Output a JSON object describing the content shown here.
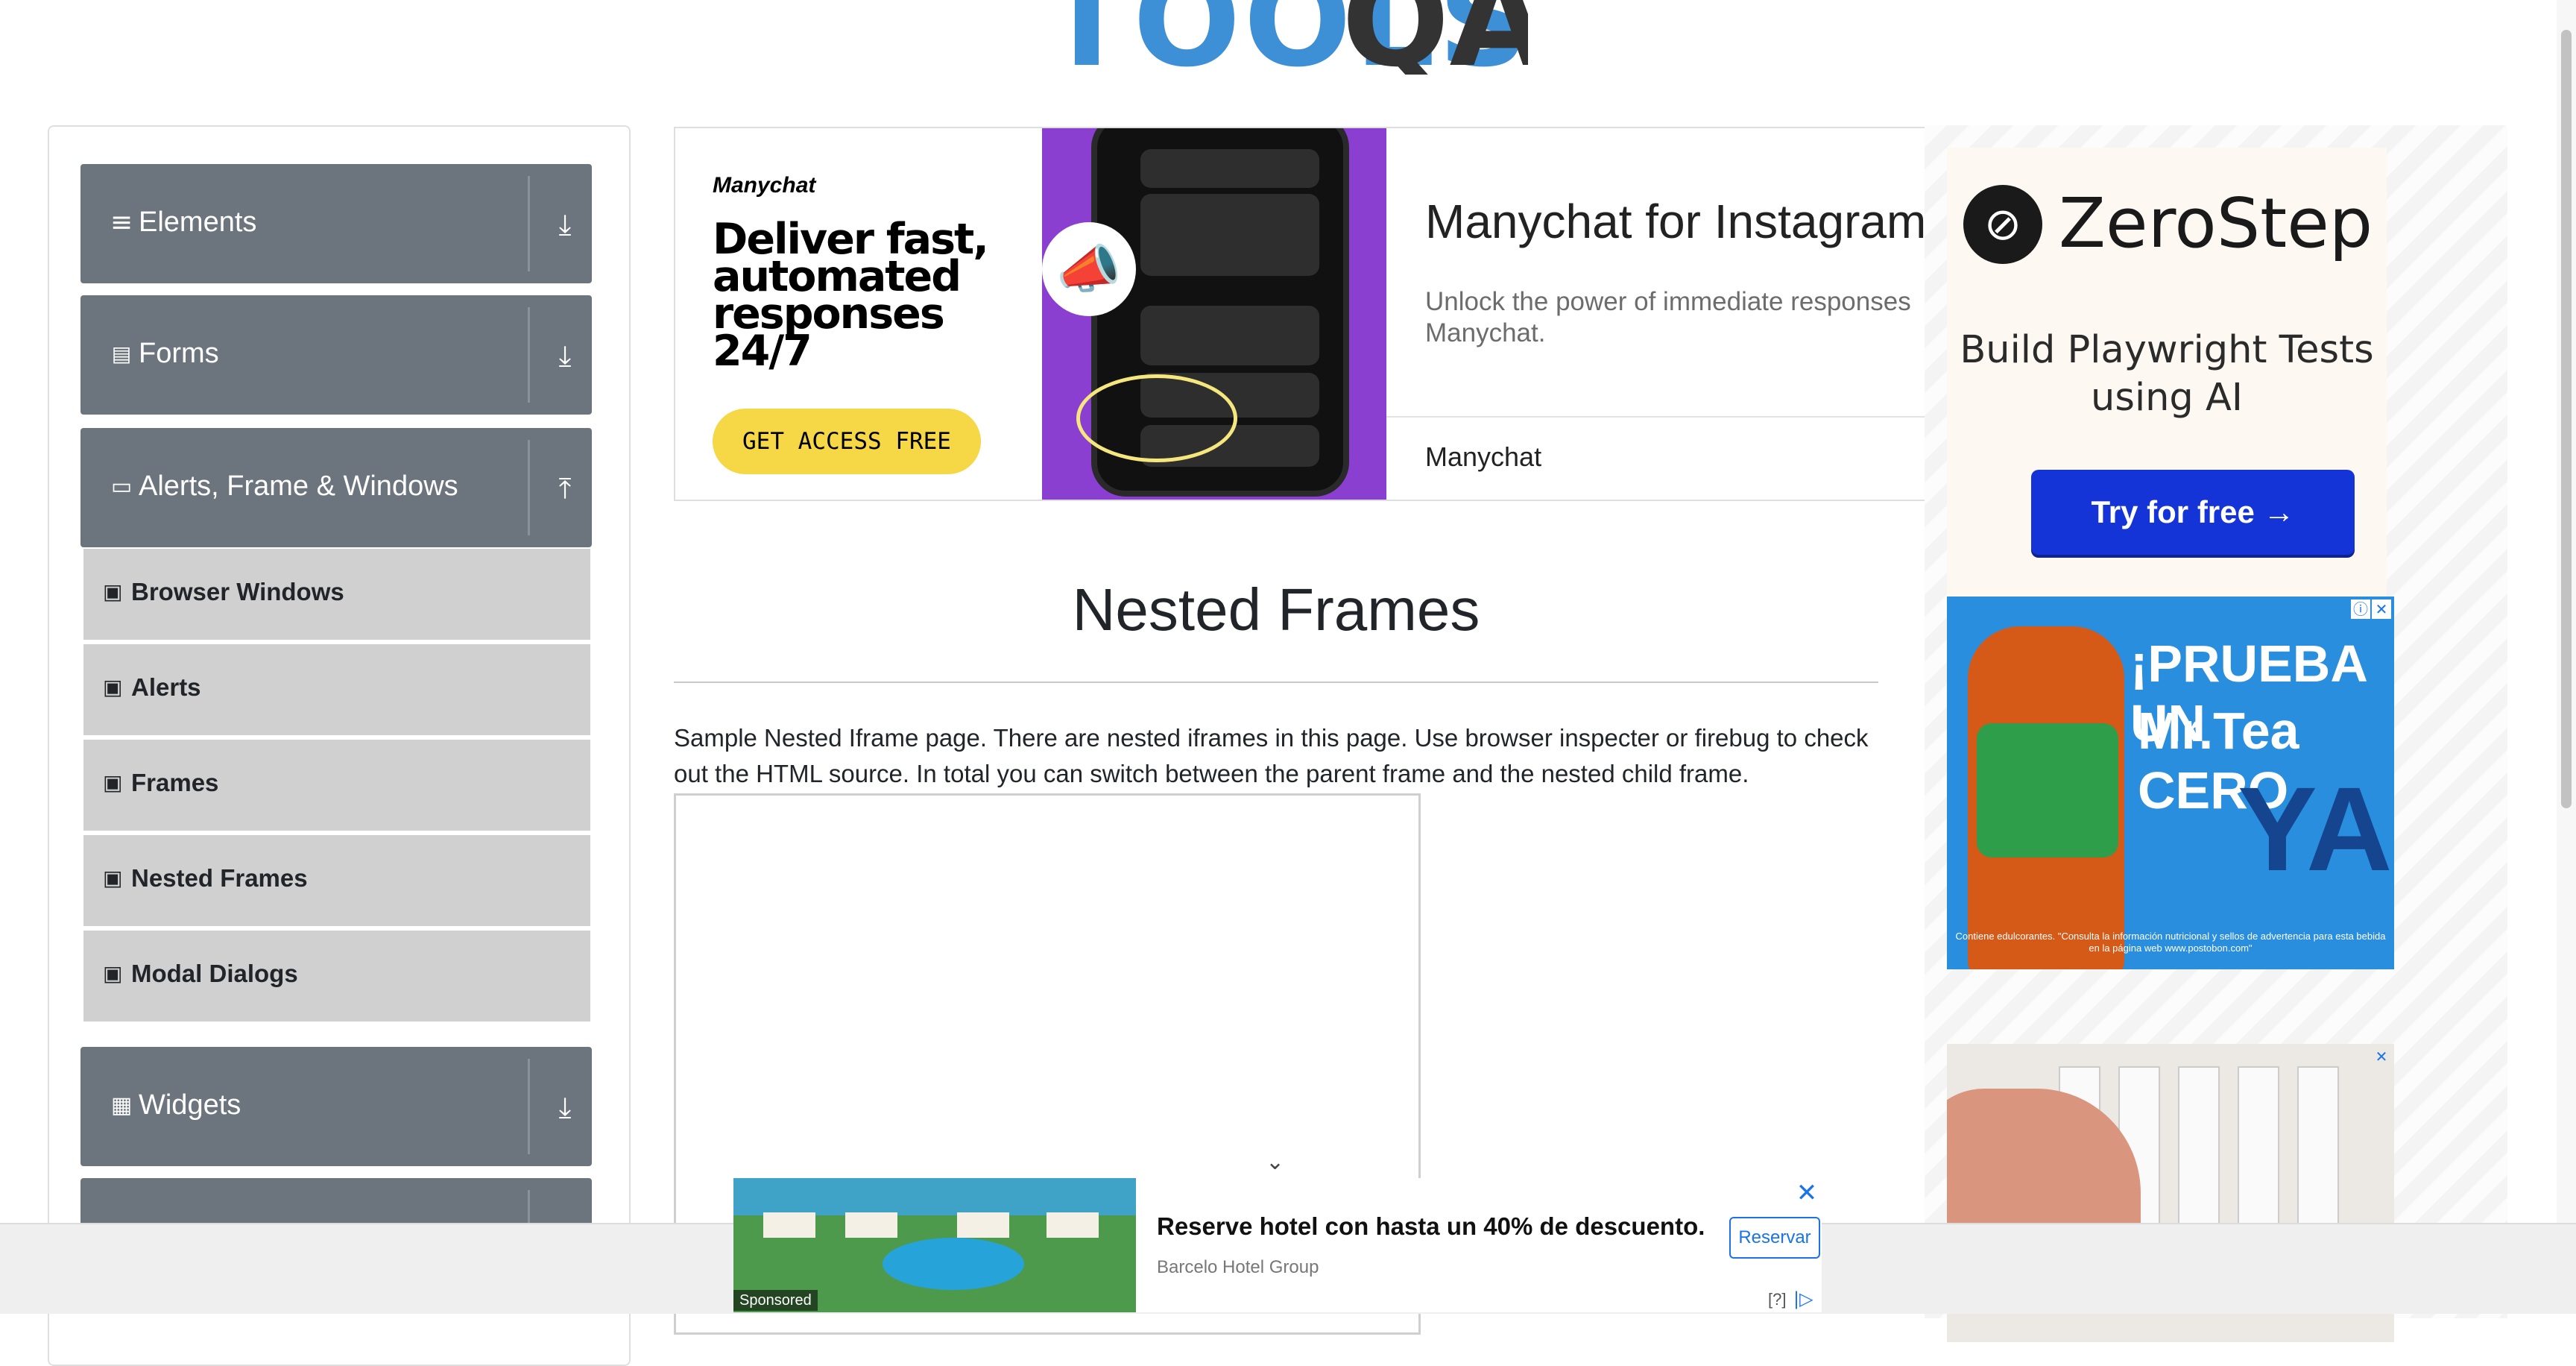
{
  "logo": {
    "text": "TOOLS",
    "qa": "QA"
  },
  "sidebar": {
    "groups": [
      {
        "label": "Elements",
        "icon": "menu-icon",
        "toggle": "download-icon"
      },
      {
        "label": "Forms",
        "icon": "document-icon",
        "toggle": "download-icon"
      },
      {
        "label": "Alerts, Frame & Windows",
        "icon": "window-icon",
        "toggle": "upload-icon"
      },
      {
        "label": "Widgets",
        "icon": "widgets-icon",
        "toggle": "download-icon"
      }
    ],
    "items": [
      {
        "label": "Browser Windows"
      },
      {
        "label": "Alerts"
      },
      {
        "label": "Frames"
      },
      {
        "label": "Nested Frames"
      },
      {
        "label": "Modal Dialogs"
      }
    ]
  },
  "top_ad": {
    "brand": "Manychat",
    "headline": "Deliver fast, automated responses 24/7",
    "cta": "GET ACCESS FREE",
    "title": "Manychat for Instagram",
    "description": "Unlock the power of immediate responses Manychat.",
    "source": "Manychat"
  },
  "right_ads": {
    "zerostep": {
      "name": "ZeroStep",
      "tagline": "Build Playwright Tests using AI",
      "button": "Try for free →"
    },
    "tea": {
      "line1": "¡PRUEBA UN",
      "line2": "Mr.Tea CERO",
      "line3": "YA!",
      "fine_print": "Contiene edulcorantes. \"Consulta la información nutricional y sellos de advertencia para esta bebida en la página web www.postobon.com\""
    },
    "info_glyph": "ⓘ",
    "close_glyph": "✕"
  },
  "main": {
    "title": "Nested Frames",
    "description": "Sample Nested Iframe page. There are nested iframes in this page. Use browser inspecter or firebug to check out the HTML source. In total you can switch between the parent frame and the nested child frame."
  },
  "bottom_ad": {
    "sponsored": "Sponsored",
    "title": "Reserve hotel con hasta un 40% de descuento.",
    "brand": "Barcelo Hotel Group",
    "button": "Reservar",
    "close": "✕",
    "help": "[?]",
    "adchoices": "|▷"
  },
  "colors": {
    "accordion_header": "#6c757d",
    "menu_item": "#d0d0d0",
    "cta_yellow": "#f6d745",
    "zerostep_blue": "#1534d8",
    "manychat_purple": "#8b3fd1"
  }
}
